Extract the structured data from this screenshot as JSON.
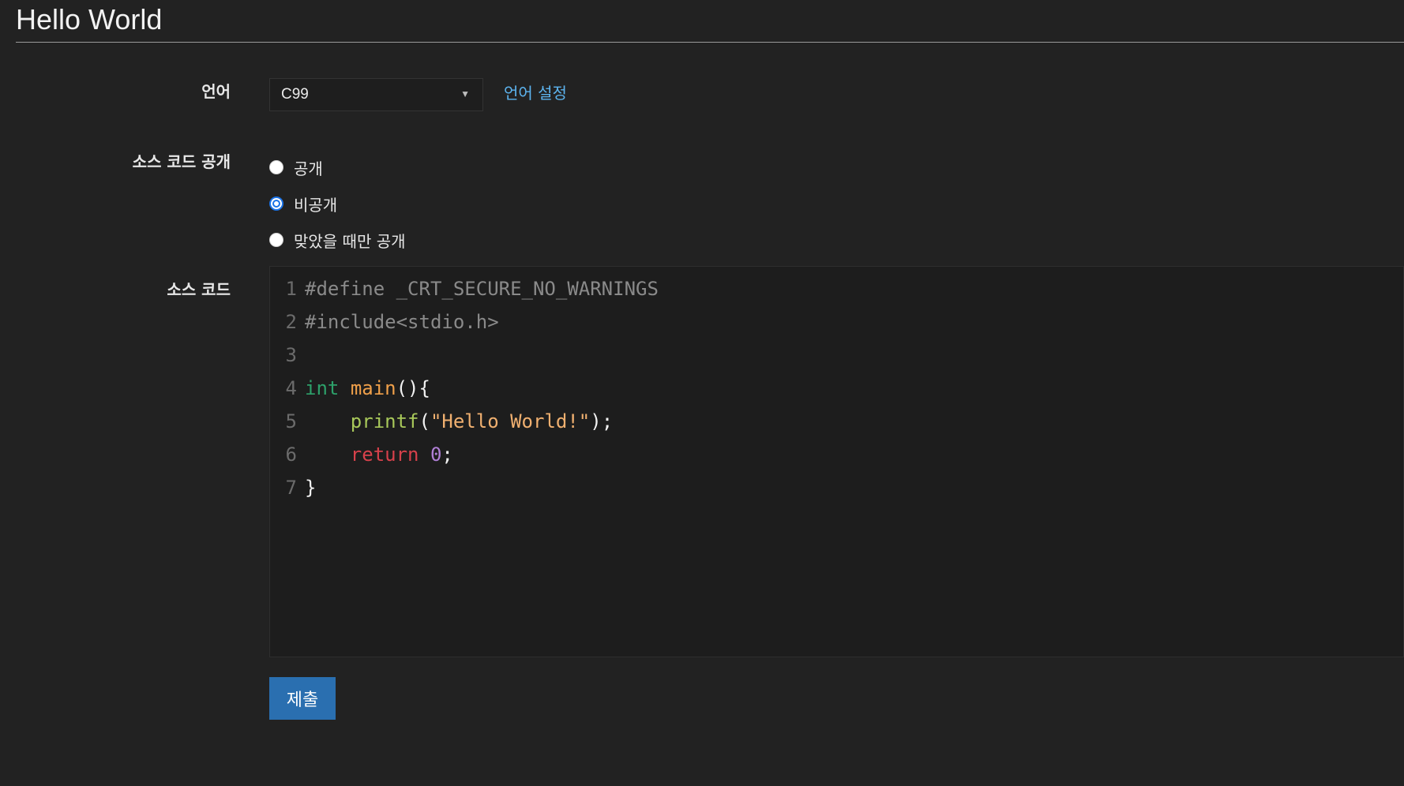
{
  "page": {
    "title": "Hello World"
  },
  "form": {
    "language_label": "언어",
    "language_selected": "C99",
    "language_settings_link": "언어 설정",
    "visibility_label": "소스 코드 공개",
    "visibility_options": [
      {
        "label": "공개",
        "checked": false
      },
      {
        "label": "비공개",
        "checked": true
      },
      {
        "label": "맞았을 때만 공개",
        "checked": false
      }
    ],
    "source_label": "소스 코드",
    "submit_label": "제출"
  },
  "editor": {
    "line_numbers": [
      "1",
      "2",
      "3",
      "4",
      "5",
      "6",
      "7"
    ],
    "lines": [
      "#define _CRT_SECURE_NO_WARNINGS",
      "#include<stdio.h>",
      "",
      "int main(){",
      "    printf(\"Hello World!\");",
      "    return 0;",
      "}"
    ],
    "tokens": {
      "l1": "#define _CRT_SECURE_NO_WARNINGS",
      "l2": "#include<stdio.h>",
      "l4_type": "int",
      "l4_sp": " ",
      "l4_fn": "main",
      "l4_punc": "(){",
      "l5_indent": "    ",
      "l5_call": "printf",
      "l5_open": "(",
      "l5_str": "\"Hello World!\"",
      "l5_close": ");",
      "l6_indent": "    ",
      "l6_kw": "return",
      "l6_sp": " ",
      "l6_num": "0",
      "l6_semi": ";",
      "l7": "}"
    }
  },
  "colors": {
    "background": "#222222",
    "accent_link": "#5cb3ee",
    "submit_button": "#2a6fb0",
    "radio_checked": "#1a73e8"
  },
  "icons": {
    "select_caret": "caret-down-icon"
  }
}
